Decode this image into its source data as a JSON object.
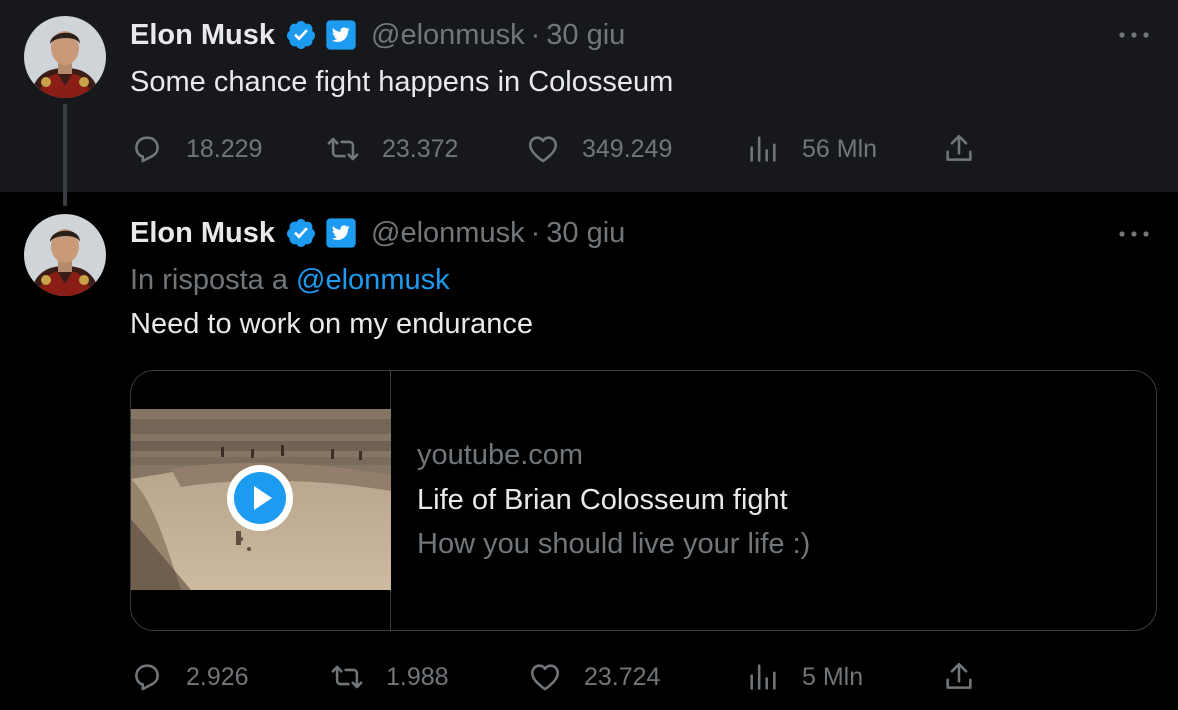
{
  "tweets": [
    {
      "author": {
        "name": "Elon Musk",
        "handle": "@elonmusk"
      },
      "date": "30 giu",
      "text": "Some chance fight happens in Colosseum",
      "stats": {
        "replies": "18.229",
        "retweets": "23.372",
        "likes": "349.249",
        "views": "56 Mln"
      }
    },
    {
      "author": {
        "name": "Elon Musk",
        "handle": "@elonmusk"
      },
      "date": "30 giu",
      "reply_to": {
        "prefix": "In risposta a",
        "mention": "@elonmusk"
      },
      "text": "Need to work on my endurance",
      "card": {
        "domain": "youtube.com",
        "title": "Life of Brian Colosseum fight",
        "description": "How you should live your life :)"
      },
      "stats": {
        "replies": "2.926",
        "retweets": "1.988",
        "likes": "23.724",
        "views": "5 Mln"
      }
    }
  ],
  "separator": "·",
  "colors": {
    "background_highlighted": "#16181c",
    "background": "#000000",
    "text_primary": "#e7e9ea",
    "text_secondary": "#71767b",
    "accent_blue": "#1d9bf0",
    "border": "#3a3d41"
  },
  "icons": [
    "verified-badge-icon",
    "affiliate-bird-icon",
    "more-options-icon",
    "reply-icon",
    "retweet-icon",
    "like-icon",
    "views-icon",
    "share-icon",
    "play-icon"
  ]
}
